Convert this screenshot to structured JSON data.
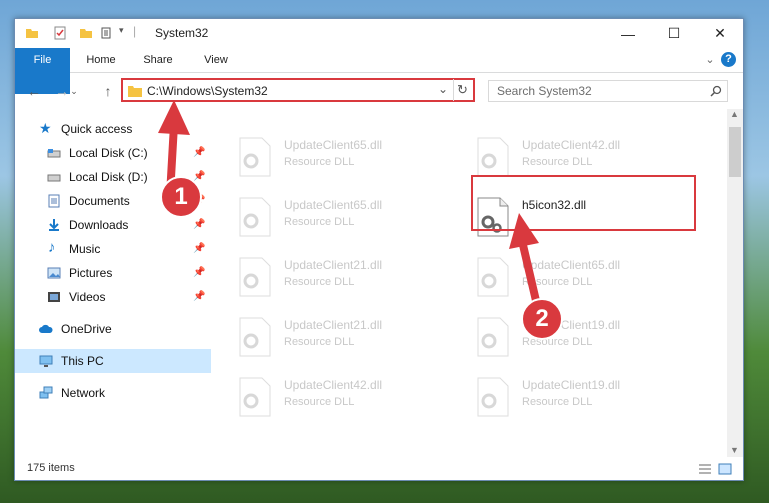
{
  "window": {
    "title": "System32"
  },
  "titlebar": {
    "minimize": "—",
    "maximize": "☐",
    "close": "✕"
  },
  "ribbon": {
    "tabs": [
      "File",
      "Home",
      "Share",
      "View"
    ],
    "expand": "⌄",
    "help": "?"
  },
  "navigation": {
    "back": "←",
    "forward": "→",
    "up": "↑",
    "address": "C:\\Windows\\System32",
    "search_placeholder": "Search System32"
  },
  "sidebar": {
    "items": [
      {
        "label": "Quick access",
        "icon": "star-icon"
      },
      {
        "label": "Local Disk (C:)",
        "icon": "drive-icon",
        "pinned": true
      },
      {
        "label": "Local Disk (D:)",
        "icon": "drive-icon",
        "pinned": true
      },
      {
        "label": "Documents",
        "icon": "documents-icon",
        "pinned": true
      },
      {
        "label": "Downloads",
        "icon": "downloads-icon",
        "pinned": true
      },
      {
        "label": "Music",
        "icon": "music-icon",
        "pinned": true
      },
      {
        "label": "Pictures",
        "icon": "pictures-icon",
        "pinned": true
      },
      {
        "label": "Videos",
        "icon": "videos-icon",
        "pinned": true
      },
      {
        "label": "OneDrive",
        "icon": "cloud-icon"
      },
      {
        "label": "This PC",
        "icon": "pc-icon",
        "selected": true
      },
      {
        "label": "Network",
        "icon": "network-icon"
      }
    ]
  },
  "files": [
    {
      "name": "UpdateClient65.dll",
      "type": "Resource DLL"
    },
    {
      "name": "UpdateClient42.dll",
      "type": "Resource DLL"
    },
    {
      "name": "UpdateClient65.dll",
      "type": "Resource DLL"
    },
    {
      "name": "h5icon32.dll",
      "type": ""
    },
    {
      "name": "UpdateClient21.dll",
      "type": "Resource DLL"
    },
    {
      "name": "UpdateClient65.dll",
      "type": "Resource DLL"
    },
    {
      "name": "UpdateClient21.dll",
      "type": "Resource DLL"
    },
    {
      "name": "UpdateClient19.dll",
      "type": "Resource DLL"
    },
    {
      "name": "UpdateClient42.dll",
      "type": "Resource DLL"
    },
    {
      "name": "UpdateClient19.dll",
      "type": "Resource DLL"
    }
  ],
  "status": {
    "items": "175 items"
  },
  "annotations": {
    "step1": "1",
    "step2": "2"
  },
  "colors": {
    "accent": "#1979ca",
    "highlight": "#d9393e",
    "selection": "#cce8ff"
  }
}
